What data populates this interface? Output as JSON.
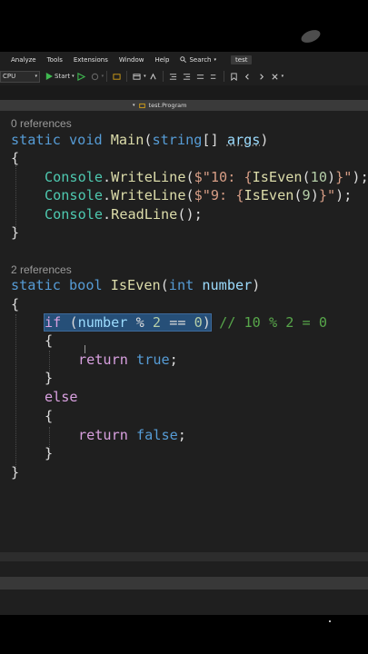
{
  "menubar": {
    "items": [
      "Analyze",
      "Tools",
      "Extensions",
      "Window",
      "Help"
    ],
    "search_label": "Search",
    "badge": "test"
  },
  "toolbar": {
    "platform": "CPU",
    "start_label": "Start"
  },
  "navbar": {
    "scope": "test.Program"
  },
  "code": {
    "main_refs": "0 references",
    "iseven_refs": "2 references",
    "l_main_kw1": "static",
    "l_main_kw2": "void",
    "l_main_name": "Main",
    "l_main_kw3": "string",
    "l_main_param": "args",
    "wl1_str": "$\"10: {",
    "wl1_call": "IsEven",
    "wl1_arg": "10",
    "wl1_end": "}\"",
    "wl2_str": "$\"9: {",
    "wl2_arg": "9",
    "class_console": "Console",
    "m_writeline": "WriteLine",
    "m_readline": "ReadLine",
    "l_ie_kw": "bool",
    "l_ie_name": "IsEven",
    "l_ie_type": "int",
    "l_ie_param": "number",
    "if_kw": "if",
    "if_var": "number",
    "if_mod": "2",
    "if_zero": "0",
    "comment": "// 10 % 2 = 0",
    "return_kw": "return",
    "true_kw": "true",
    "false_kw": "false",
    "else_kw": "else"
  }
}
